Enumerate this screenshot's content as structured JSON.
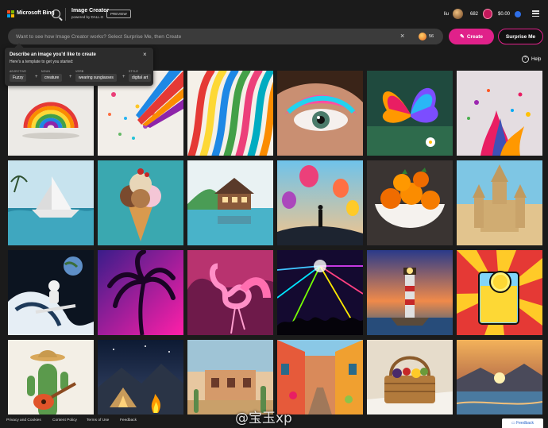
{
  "header": {
    "brand": "Microsoft Bing",
    "product_title": "Image Creator",
    "product_subtitle": "powered by DALL·E",
    "preview_badge": "PREVIEW",
    "user_name": "liu",
    "reward_points": "682",
    "balance": "$0.00",
    "colors": {
      "ms_red": "#f25022",
      "ms_green": "#7fba00",
      "ms_blue": "#00a4ef",
      "ms_yellow": "#ffb900"
    }
  },
  "prompt": {
    "placeholder": "Want to see how Image Creator works? Select Surprise Me, then Create",
    "boosts": "56",
    "create_label": "Create",
    "surprise_label": "Surprise Me",
    "accent": "#e0218a"
  },
  "tooltip": {
    "title": "Describe an image you'd like to create",
    "subtitle": "Here's a template to get you started:",
    "chips": [
      {
        "label": "ADJECTIVE",
        "value": "Fuzzy"
      },
      {
        "label": "NOUN",
        "value": "creature"
      },
      {
        "label": "VERB",
        "value": "wearing sunglasses"
      },
      {
        "label": "STYLE",
        "value": "digital art"
      }
    ]
  },
  "help_label": "Help",
  "gallery": {
    "tiles": [
      "rainbow",
      "paint-pencils",
      "color-ribbons",
      "eye-makeup",
      "butterfly",
      "paint-splash",
      "paper-boat",
      "ice-cream",
      "lake-house",
      "hot-air-balloons",
      "oranges",
      "sand-castle",
      "astronaut-surfer",
      "palm-tree",
      "flamingo",
      "concert-lasers",
      "lighthouse",
      "lemonade",
      "cactus-guitar",
      "campfire",
      "desert-house",
      "colorful-street",
      "picnic-basket",
      "sunset-lake"
    ]
  },
  "footer": {
    "links": [
      "Privacy and Cookies",
      "Content Policy",
      "Terms of Use",
      "Feedback"
    ],
    "feedback_button": "Feedback",
    "watermark": "@宝玉xp"
  }
}
